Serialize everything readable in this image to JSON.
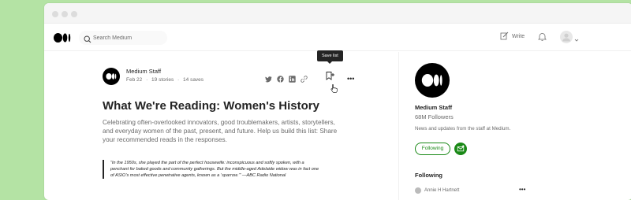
{
  "topbar": {
    "search_placeholder": "Search Medium",
    "write_label": "Write"
  },
  "list": {
    "author": "Medium Staff",
    "date": "Feb 22",
    "stories": "19 stories",
    "saves": "14 saves",
    "tooltip": "Save list",
    "title": "What We're Reading: Women's History",
    "description": "Celebrating often-overlooked innovators, good troublemakers, artists, storytellers, and everyday women of the past, present, and future. Help us build this list: Share your recommended reads in the responses.",
    "quote": "“In the 1950s, she played the part of the perfect housewife: inconspicuous and softly spoken, with a penchant for baked goods and community gatherings. But the middle-aged Adelaide widow was in fact one of ASIO's most effective penetrative agents, known as a ‘sparrow.’” —ABC Radio National"
  },
  "sidebar": {
    "name": "Medium Staff",
    "followers": "68M Followers",
    "bio": "News and updates from the staff at Medium.",
    "following_button": "Following",
    "following_heading": "Following",
    "following_item": "Annie H Hartnett"
  },
  "colors": {
    "background": "#b4e3a4",
    "accent_green": "#1a8917",
    "text": "#242424",
    "muted": "#6b6b6b"
  },
  "icons": [
    "medium-logo-icon",
    "search-icon",
    "write-icon",
    "bell-icon",
    "user-avatar-icon",
    "twitter-icon",
    "facebook-icon",
    "linkedin-icon",
    "link-icon",
    "save-list-icon",
    "more-icon",
    "cursor-hand-icon",
    "subscribe-mail-icon"
  ]
}
